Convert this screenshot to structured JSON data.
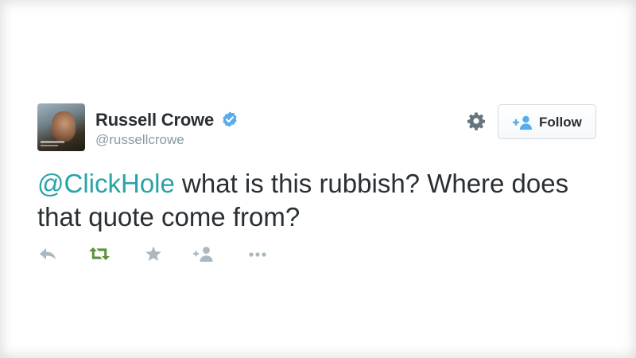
{
  "tweet": {
    "author": {
      "display_name": "Russell Crowe",
      "username": "@russellcrowe",
      "verified": true
    },
    "mention": "@ClickHole",
    "body": " what is this rubbish? Where does that quote come from?",
    "retweeted": true
  },
  "header": {
    "follow_label": "Follow"
  },
  "icons": {
    "verified": "verified-badge-icon",
    "settings": "gear-icon",
    "follow": "add-person-icon",
    "reply": "reply-icon",
    "retweet": "retweet-icon",
    "favorite": "star-icon",
    "follow_action": "add-person-icon",
    "more": "ellipsis-icon"
  },
  "colors": {
    "accent_link": "#2aa3a8",
    "verified_blue": "#55acee",
    "retweet_active": "#5c913b",
    "icon_muted": "#aab8c2",
    "text": "#292f33",
    "secondary_text": "#8899a6"
  }
}
